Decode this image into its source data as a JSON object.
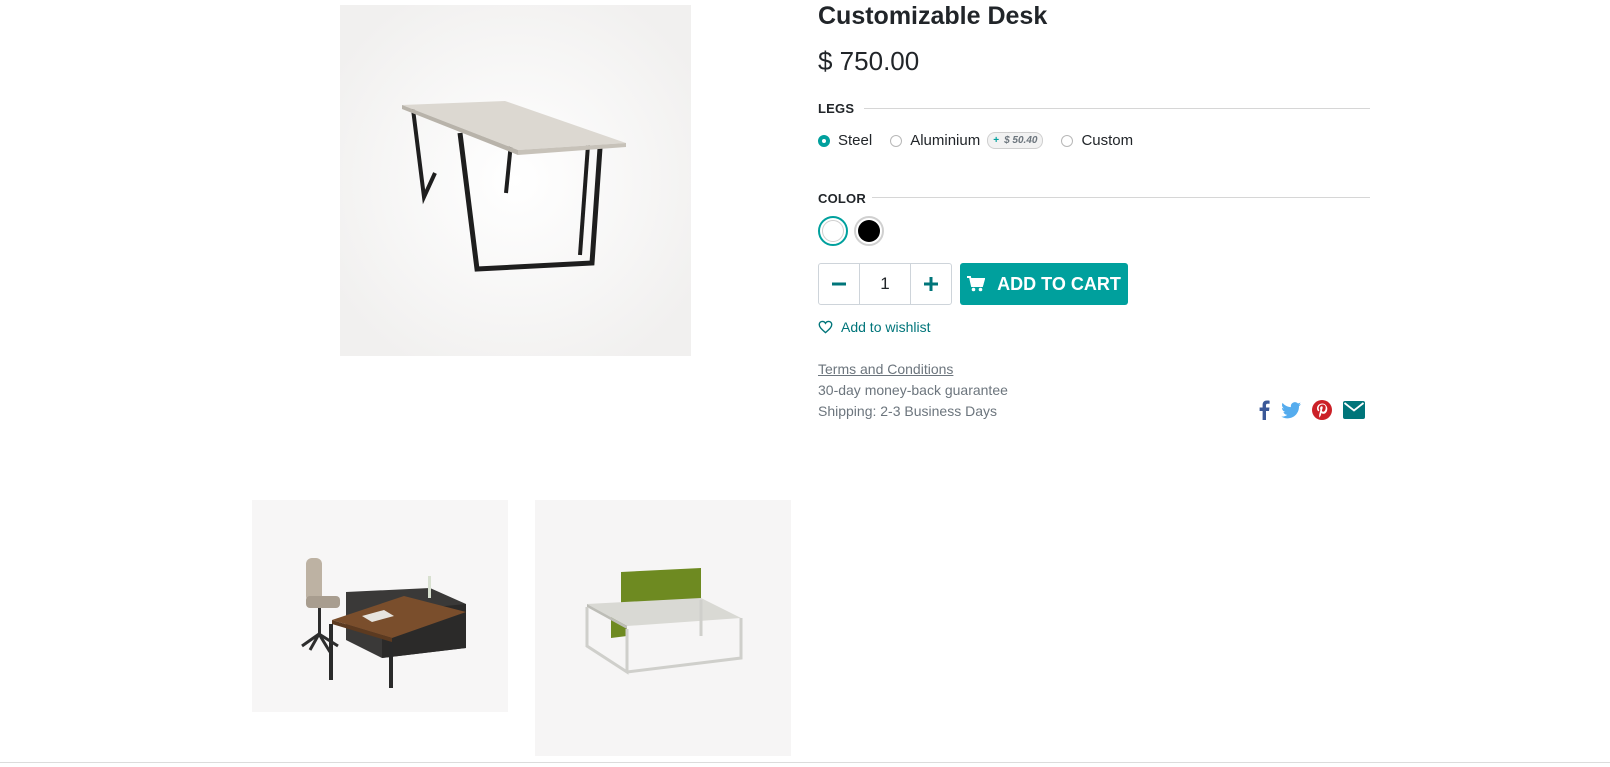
{
  "product": {
    "title": "Customizable Desk",
    "price": "$ 750.00"
  },
  "legs": {
    "label": "LEGS",
    "options": [
      {
        "label": "Steel",
        "selected": true
      },
      {
        "label": "Aluminium",
        "selected": false,
        "extra_price": "$ 50.40",
        "extra_sign": "+"
      },
      {
        "label": "Custom",
        "selected": false
      }
    ]
  },
  "color": {
    "label": "COLOR",
    "options": [
      {
        "name": "White",
        "hex": "#ffffff",
        "selected": true
      },
      {
        "name": "Black",
        "hex": "#000000",
        "selected": false
      }
    ]
  },
  "quantity": {
    "value": "1",
    "minus_icon": "minus-icon",
    "plus_icon": "plus-icon"
  },
  "cart": {
    "label": "ADD TO CART",
    "icon": "shopping-cart-icon",
    "color": "#00a09d"
  },
  "wishlist": {
    "label": "Add to wishlist",
    "icon": "heart-icon"
  },
  "info": {
    "terms": "Terms and Conditions",
    "guarantee": "30-day money-back guarantee",
    "shipping": "Shipping: 2-3 Business Days"
  },
  "share": [
    {
      "icon": "facebook-icon",
      "color": "#3b5998"
    },
    {
      "icon": "twitter-icon",
      "color": "#55acee"
    },
    {
      "icon": "pinterest-icon",
      "color": "#cb2027"
    },
    {
      "icon": "email-icon",
      "color": "#00757a"
    }
  ],
  "accent_color": "#00a09d"
}
